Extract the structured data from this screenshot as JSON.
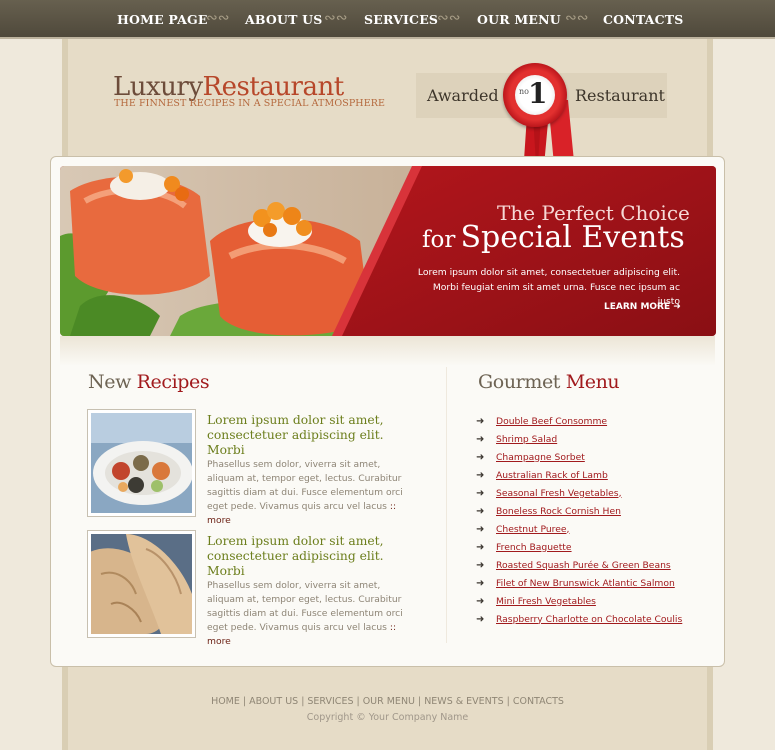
{
  "nav": {
    "items": [
      {
        "label": "HOME PAGE"
      },
      {
        "label": "ABOUT US"
      },
      {
        "label": "SERVICES"
      },
      {
        "label": "OUR MENU"
      },
      {
        "label": "CONTACTS"
      }
    ],
    "separator": "ஜ"
  },
  "logo": {
    "part1": "Luxury",
    "part2": "Restaurant",
    "tagline": "THE FINNEST RECIPES IN A SPECIAL ATMOSPHERE"
  },
  "award": {
    "left": "Awarded",
    "right": "Restaurant",
    "no": "no",
    "number": "1"
  },
  "banner": {
    "title_line1": "The Perfect Choice",
    "title_line2_small": "for",
    "title_line2_big": "Special Events",
    "text": "Lorem ipsum dolor sit amet, consectetuer adipiscing elit. Morbi feugiat enim sit amet urna. Fusce nec ipsum ac justo",
    "learn_more": "LEARN MORE"
  },
  "recipes": {
    "heading_part1": "New",
    "heading_part2": "Recipes",
    "items": [
      {
        "title": "Lorem ipsum dolor sit amet, consectetuer adipiscing elit. Morbi",
        "text": "Phasellus sem dolor, viverra sit amet, aliquam at, tempor eget, lectus. Curabitur sagittis diam at dui. Fusce elementum orci eget pede. Vivamus quis arcu vel lacus",
        "more": "more"
      },
      {
        "title": "Lorem ipsum dolor sit amet, consectetuer adipiscing elit. Morbi",
        "text": "Phasellus sem dolor, viverra sit amet, aliquam at, tempor eget, lectus. Curabitur sagittis diam at dui. Fusce elementum orci eget pede. Vivamus quis arcu vel lacus",
        "more": "more"
      }
    ]
  },
  "menu": {
    "heading_part1": "Gourmet",
    "heading_part2": "Menu",
    "items": [
      "Double Beef Consomme",
      "Shrimp Salad",
      "Champagne Sorbet",
      "Australian Rack of Lamb",
      "Seasonal Fresh Vegetables,",
      "Boneless Rock Cornish Hen",
      "Chestnut Puree,",
      "French Baguette",
      "Roasted Squash Purée & Green Beans",
      "Filet of New Brunswick Atlantic Salmon",
      "Mini Fresh Vegetables",
      "Raspberry Charlotte on Chocolate Coulis"
    ]
  },
  "footer": {
    "links": [
      "HOME",
      "ABOUT US",
      "SERVICES",
      "OUR MENU",
      "NEWS & EVENTS",
      "CONTACTS"
    ],
    "copyright": "Copyright © Your Company Name"
  },
  "colors": {
    "nav_bg": "#5a5344",
    "accent_red": "#a11a1d",
    "recipe_title_green": "#6c7e1c",
    "page_bg": "#efe9dc"
  }
}
